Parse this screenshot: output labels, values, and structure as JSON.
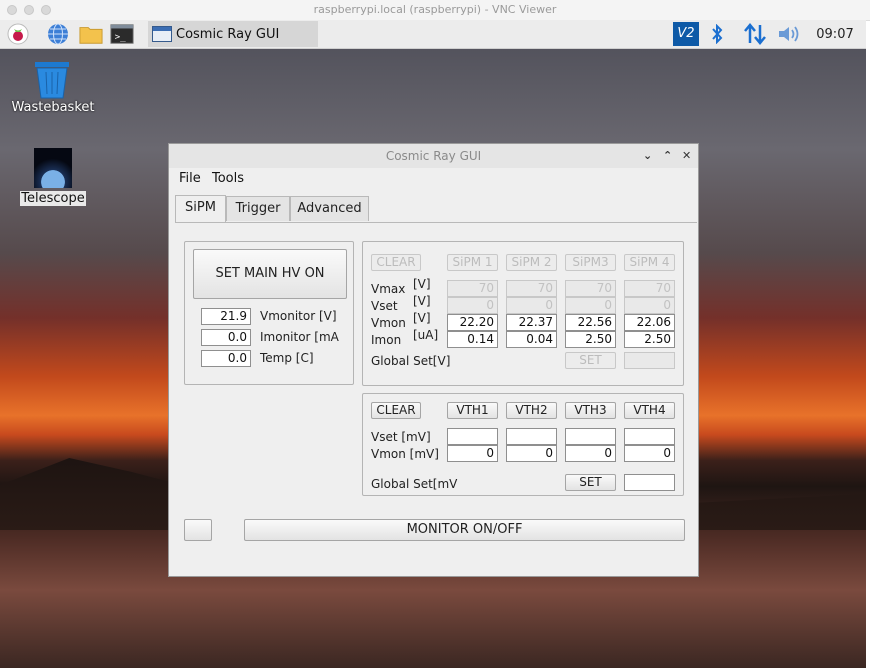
{
  "vnc": {
    "title": "raspberrypi.local (raspberrypi) - VNC Viewer"
  },
  "taskbar": {
    "task_label": "Cosmic Ray GUI",
    "clock": "09:07",
    "vnc_icon_text": "V2"
  },
  "desktop": {
    "icons": [
      {
        "label": "Wastebasket"
      },
      {
        "label": "Telescope"
      }
    ]
  },
  "app": {
    "title": "Cosmic Ray GUI",
    "menu": [
      "File",
      "Tools"
    ],
    "tabs": [
      "SiPM",
      "Trigger",
      "Advanced"
    ],
    "left_panel": {
      "hv_button": "SET MAIN HV ON",
      "rows": [
        {
          "value": "21.9",
          "label": "Vmonitor [V]"
        },
        {
          "value": "0.0",
          "label": "Imonitor [mA"
        },
        {
          "value": "0.0",
          "label": "Temp [C]"
        }
      ]
    },
    "sipm_panel": {
      "clear": "CLEAR",
      "headers": [
        "SiPM 1",
        "SiPM 2",
        "SiPM3",
        "SiPM 4"
      ],
      "row_labels": [
        "Vmax",
        "Vset",
        "Vmon",
        "Imon"
      ],
      "row_units": [
        "[V]",
        "[V]",
        "[V]",
        "[uA]"
      ],
      "vmax": [
        "70",
        "70",
        "70",
        "70"
      ],
      "vset": [
        "0",
        "0",
        "0",
        "0"
      ],
      "vmon": [
        "22.20",
        "22.37",
        "22.56",
        "22.06"
      ],
      "imon": [
        "0.14",
        "0.04",
        "2.50",
        "2.50"
      ],
      "global_label": "Global Set[V]",
      "set": "SET"
    },
    "vth_panel": {
      "clear": "CLEAR",
      "headers": [
        "VTH1",
        "VTH2",
        "VTH3",
        "VTH4"
      ],
      "vset_label": "Vset [mV]",
      "vmon_label": "Vmon [mV]",
      "vmon": [
        "0",
        "0",
        "0",
        "0"
      ],
      "global_label": "Global Set[mV",
      "set": "SET"
    },
    "monitor_button": "MONITOR ON/OFF"
  }
}
